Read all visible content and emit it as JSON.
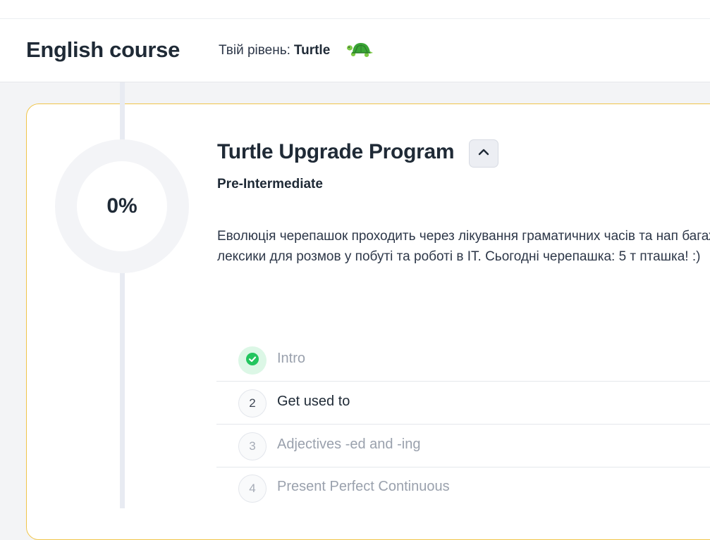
{
  "header": {
    "course_title": "English course",
    "level_label": "Твій рівень:",
    "level_value": "Turtle",
    "level_icon": "turtle-icon"
  },
  "program": {
    "progress_percent": 0,
    "progress_text": "0%",
    "title": "Turtle Upgrade Program",
    "collapse_icon": "chevron-up-icon",
    "level": "Pre-Intermediate",
    "description": "Еволюція черепашок проходить через лікування граматичних часів та нап багажу лексики для розмов у побуті та роботі в IT. Сьогодні черепашка: 5 т пташка! :)"
  },
  "lessons": [
    {
      "badge": "",
      "status": "completed",
      "icon": "check-icon",
      "title": "Intro"
    },
    {
      "badge": "2",
      "status": "current",
      "title": "Get used to"
    },
    {
      "badge": "3",
      "status": "locked",
      "title": "Adjectives -ed and -ing"
    },
    {
      "badge": "4",
      "status": "locked",
      "title": "Present Perfect Continuous"
    }
  ],
  "colors": {
    "accent_border": "#f0c54a",
    "completed": "#22c55e",
    "muted_text": "#9aa1ad"
  }
}
